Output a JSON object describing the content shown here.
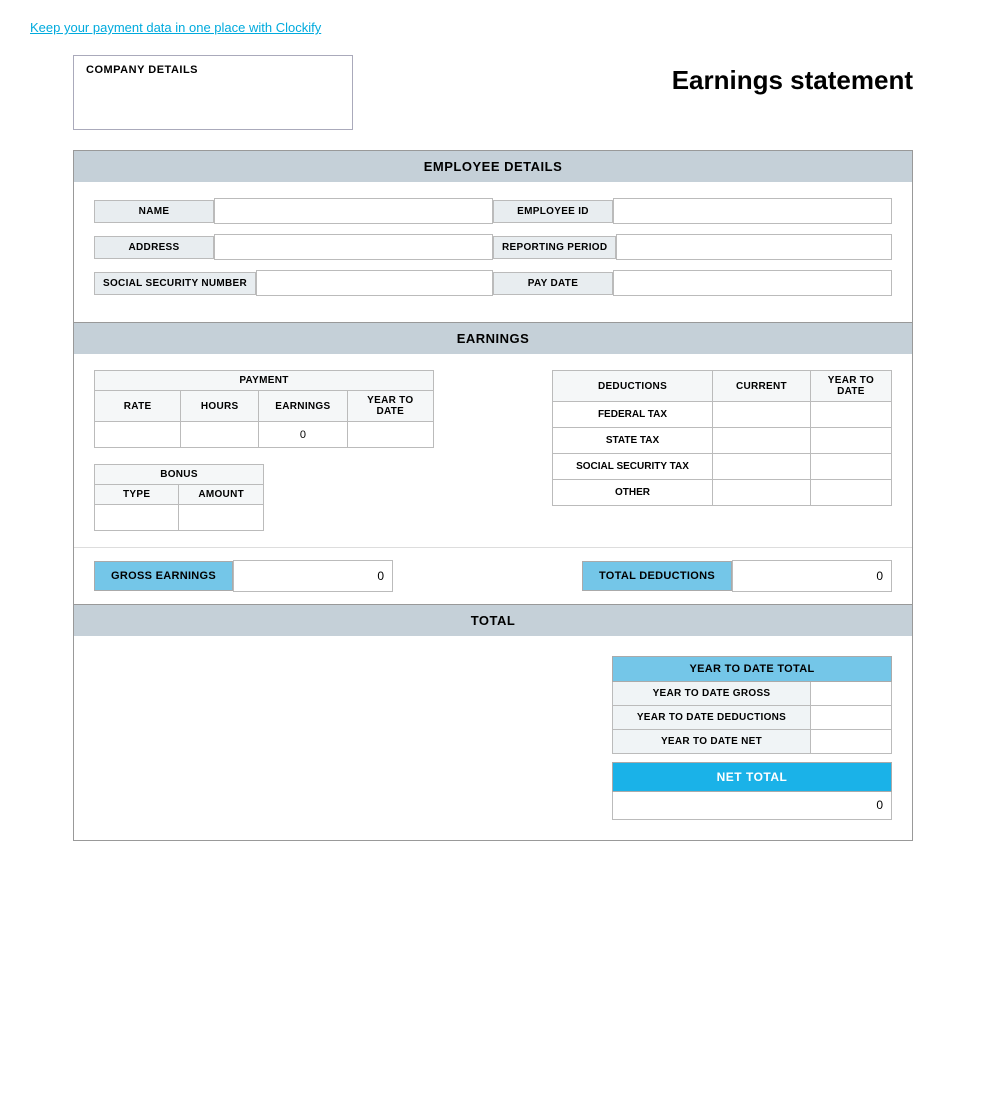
{
  "topLink": {
    "text": "Keep your payment data in one place with Clockify",
    "href": "#"
  },
  "header": {
    "company_label": "COMPANY DETAILS",
    "title": "Earnings statement"
  },
  "employeeDetails": {
    "section_title": "EMPLOYEE DETAILS",
    "fields_left": [
      {
        "label": "NAME",
        "value": ""
      },
      {
        "label": "ADDRESS",
        "value": ""
      },
      {
        "label": "SOCIAL SECURITY NUMBER",
        "value": ""
      }
    ],
    "fields_right": [
      {
        "label": "EMPLOYEE ID",
        "value": ""
      },
      {
        "label": "REPORTING PERIOD",
        "value": ""
      },
      {
        "label": "PAY DATE",
        "value": ""
      }
    ]
  },
  "earnings": {
    "section_title": "EARNINGS",
    "payment": {
      "block_label": "PAYMENT",
      "columns": [
        "RATE",
        "HOURS",
        "EARNINGS",
        "YEAR TO DATE"
      ],
      "rows": [
        {
          "rate": "",
          "hours": "",
          "earnings": "0",
          "ytd": ""
        }
      ]
    },
    "deductions": {
      "block_label": "DEDUCTIONS",
      "columns_header": [
        "CURRENT",
        "YEAR TO DATE"
      ],
      "rows": [
        {
          "label": "FEDERAL TAX",
          "current": "",
          "ytd": ""
        },
        {
          "label": "STATE TAX",
          "current": "",
          "ytd": ""
        },
        {
          "label": "SOCIAL SECURITY TAX",
          "current": "",
          "ytd": ""
        },
        {
          "label": "OTHER",
          "current": "",
          "ytd": ""
        }
      ]
    },
    "bonus": {
      "block_label": "BONUS",
      "columns": [
        "TYPE",
        "AMOUNT"
      ],
      "rows": [
        {
          "type": "",
          "amount": ""
        }
      ]
    },
    "gross_earnings_label": "GROSS EARNINGS",
    "gross_earnings_value": "0",
    "total_deductions_label": "TOTAL DEDUCTIONS",
    "total_deductions_value": "0"
  },
  "total": {
    "section_title": "TOTAL",
    "ytd_block_label": "YEAR TO DATE TOTAL",
    "ytd_rows": [
      {
        "label": "YEAR TO DATE GROSS",
        "value": ""
      },
      {
        "label": "YEAR TO DATE DEDUCTIONS",
        "value": ""
      },
      {
        "label": "YEAR TO DATE NET",
        "value": ""
      }
    ],
    "net_total_label": "NET TOTAL",
    "net_total_value": "0"
  }
}
